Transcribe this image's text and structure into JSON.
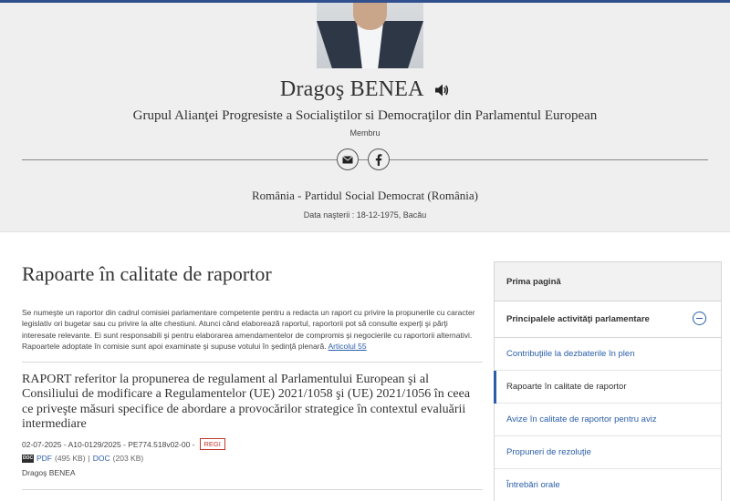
{
  "profile": {
    "name": "Dragoş BENEA",
    "group": "Grupul Alianţei Progresiste a Socialiştilor si Democraţilor din Parlamentul European",
    "role": "Membru",
    "country_party": "România - Partidul Social Democrat (România)",
    "birth": "Data naşterii : 18-12-1975, Bacău"
  },
  "main": {
    "title": "Rapoarte în calitate de raportor",
    "intro": "Se numeşte un raportor din cadrul comisiei parlamentare competente pentru a redacta un raport cu privire la propunerile cu caracter legislativ ori bugetar sau cu privire la alte chestiuni. Atunci când elaborează raportul, raportorii pot să consulte experţi şi părţi interesate relevante. Ei sunt responsabili şi pentru elaborarea amendamentelor de compromis şi negocierile cu raportorii alternativi. Rapoartele adoptate în comisie sunt apoi examinate şi supuse votului în şedinţă plenară.",
    "intro_link": "Articolul 55",
    "report": {
      "title": "RAPORT referitor la propunerea de regulament al Parlamentului European şi al Consiliului de modificare a Regulamentelor (UE) 2021/1058 şi (UE) 2021/1056 în ceea ce priveşte măsuri specifice de abordare a provocărilor strategice în contextul evaluării intermediare",
      "meta": "02-07-2025 - A10-0129/2025 - PE774.518v02-00 -",
      "tag": "REGI",
      "doc_icon": "DOC",
      "pdf_label": "PDF",
      "pdf_size": "(495 KB)",
      "pipe": "|",
      "doc_label": "DOC",
      "doc_size": "(203 KB)",
      "author": "Dragoş BENEA"
    }
  },
  "sidebar": {
    "home": "Prima pagină",
    "section": "Principalele activităţi parlamentare",
    "items": [
      {
        "label": "Contribuţiile la dezbaterile în plen"
      },
      {
        "label": "Rapoarte în calitate de raportor"
      },
      {
        "label": "Avize în calitate de raportor pentru aviz"
      },
      {
        "label": "Propuneri de rezoluţie"
      },
      {
        "label": "Întrebări orale"
      }
    ]
  },
  "icons": {
    "speaker": "speaker-icon",
    "email": "email-icon",
    "facebook": "facebook-icon"
  },
  "colors": {
    "accent": "#2a5ea8",
    "tag": "#c0392b",
    "header_bg": "#efefef"
  }
}
